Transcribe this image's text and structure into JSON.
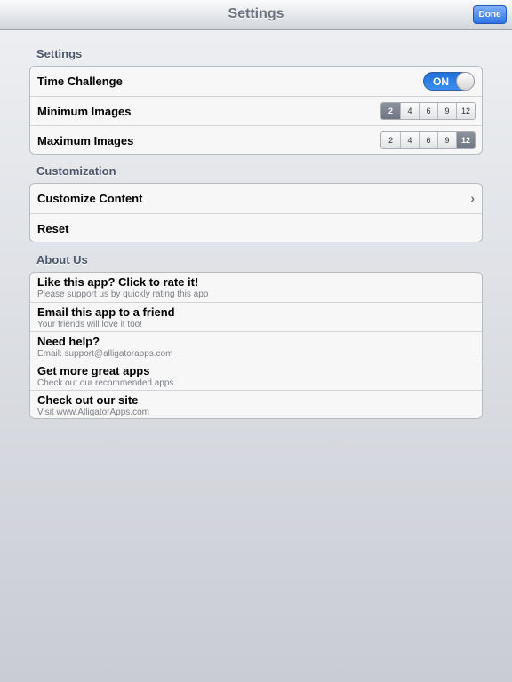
{
  "navbar": {
    "title": "Settings",
    "done_label": "Done"
  },
  "sections": {
    "settings": {
      "header": "Settings",
      "time_challenge": {
        "label": "Time Challenge",
        "toggle_state": "ON"
      },
      "minimum_images": {
        "label": "Minimum Images",
        "options": [
          "2",
          "4",
          "6",
          "9",
          "12"
        ],
        "selected": "2"
      },
      "maximum_images": {
        "label": "Maximum Images",
        "options": [
          "2",
          "4",
          "6",
          "9",
          "12"
        ],
        "selected": "12"
      }
    },
    "customization": {
      "header": "Customization",
      "items": [
        {
          "label": "Customize Content",
          "icon": "chevron-right-icon"
        },
        {
          "label": "Reset"
        }
      ]
    },
    "about": {
      "header": "About Us",
      "items": [
        {
          "title": "Like this app? Click to rate it!",
          "subtitle": "Please support us by quickly rating this app"
        },
        {
          "title": "Email this app to a friend",
          "subtitle": "Your friends will love it too!"
        },
        {
          "title": "Need help?",
          "subtitle": "Email: support@alligatorapps.com"
        },
        {
          "title": "Get more great apps",
          "subtitle": "Check out our recommended apps"
        },
        {
          "title": "Check out our site",
          "subtitle": "Visit www.AlligatorApps.com"
        }
      ]
    }
  },
  "colors": {
    "accent": "#2f74e3",
    "selected_segment": "#7a818c"
  }
}
